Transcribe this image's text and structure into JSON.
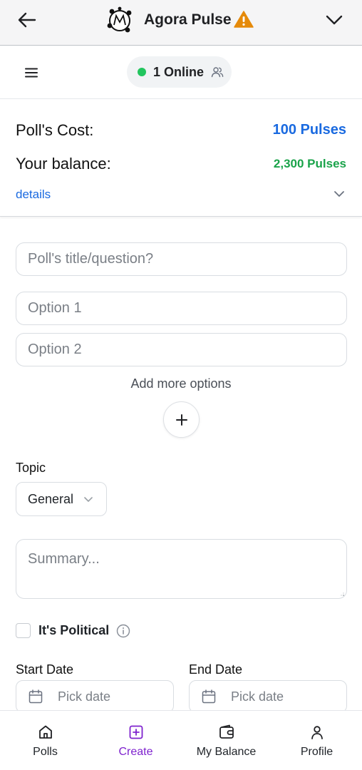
{
  "header": {
    "app_title": "Agora Pulse",
    "logo_letter": "M"
  },
  "subbar": {
    "online_text": "1 Online"
  },
  "cost": {
    "cost_label": "Poll's Cost:",
    "cost_value": "100 Pulses",
    "balance_label": "Your balance:",
    "balance_value": "2,300 Pulses",
    "details_link": "details"
  },
  "form": {
    "title_placeholder": "Poll's title/question?",
    "option1_placeholder": "Option 1",
    "option2_placeholder": "Option 2",
    "add_more_label": "Add more options",
    "topic_label": "Topic",
    "topic_value": "General",
    "summary_placeholder": "Summary...",
    "political_label": "It's Political",
    "start_date_label": "Start Date",
    "end_date_label": "End Date",
    "start_date_placeholder": "Pick date",
    "end_date_placeholder": "Pick date"
  },
  "nav": {
    "items": [
      {
        "label": "Polls",
        "icon": "home-icon"
      },
      {
        "label": "Create",
        "icon": "plus-square-icon"
      },
      {
        "label": "My Balance",
        "icon": "wallet-icon"
      },
      {
        "label": "Profile",
        "icon": "user-icon"
      }
    ],
    "active_index": 1
  },
  "colors": {
    "accent_blue": "#1a6ae0",
    "balance_green": "#1aa34a",
    "online_green": "#22c55e",
    "warning_orange": "#e58a0a",
    "active_purple": "#7e22ce"
  }
}
